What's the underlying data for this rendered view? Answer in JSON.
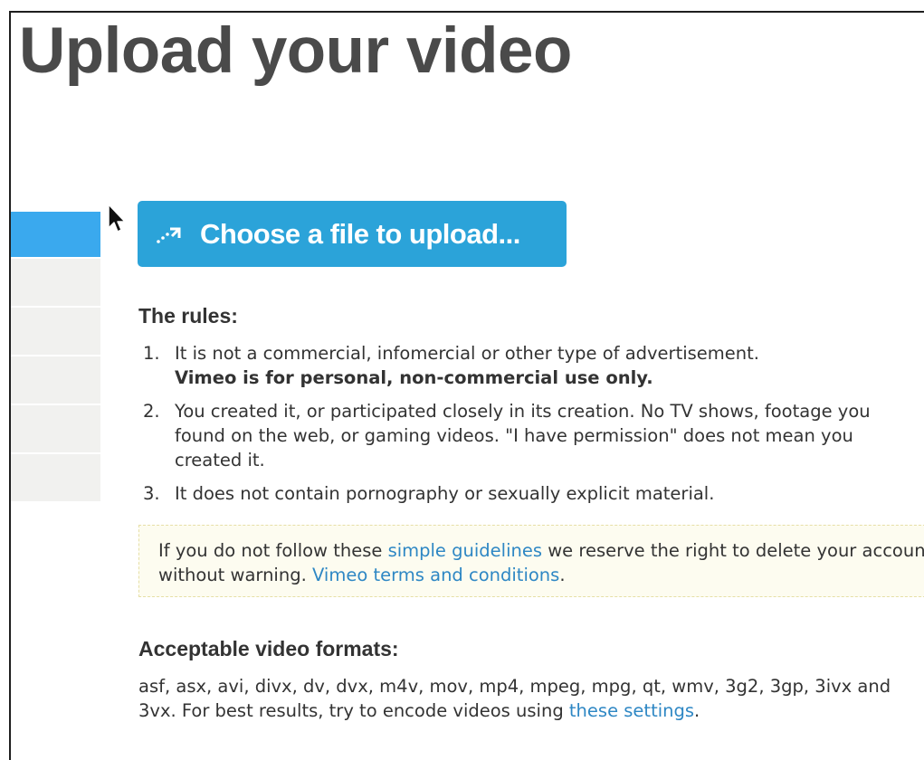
{
  "page": {
    "title": "Upload your video"
  },
  "upload_button": {
    "label": "Choose a file to upload..."
  },
  "rules": {
    "heading": "The rules:",
    "items": [
      {
        "num": "1.",
        "text": "It is not a commercial, infomercial or other type of advertisement.",
        "bold": "Vimeo is for personal, non-commercial use only."
      },
      {
        "num": "2.",
        "text": "You created it, or participated closely in its creation. No TV shows, footage you found on the web, or gaming videos. \"I have permission\" does not mean you created it."
      },
      {
        "num": "3.",
        "text": "It does not contain pornography or sexually explicit material."
      }
    ]
  },
  "notice": {
    "text_before": "If you do not follow these ",
    "guidelines_link": "simple guidelines",
    "text_middle": " we reserve the right to delete your account without warning. ",
    "terms_link": "Vimeo terms and conditions",
    "text_after": "."
  },
  "formats": {
    "heading": "Acceptable video formats:",
    "text_before": "asf, asx, avi, divx, dv, dvx, m4v, mov, mp4, mpeg, mpg, qt, wmv, 3g2, 3gp, 3ivx and 3vx. For best results, try to encode videos using ",
    "settings_link": "these settings",
    "text_after": "."
  },
  "colors": {
    "accent": "#2ba3d9",
    "sidebar_active": "#3aa9ee",
    "link": "#2e87c4",
    "title": "#4a4a4a"
  },
  "icons": {
    "upload": "upload-arrow-icon",
    "cursor": "mouse-pointer-icon"
  }
}
